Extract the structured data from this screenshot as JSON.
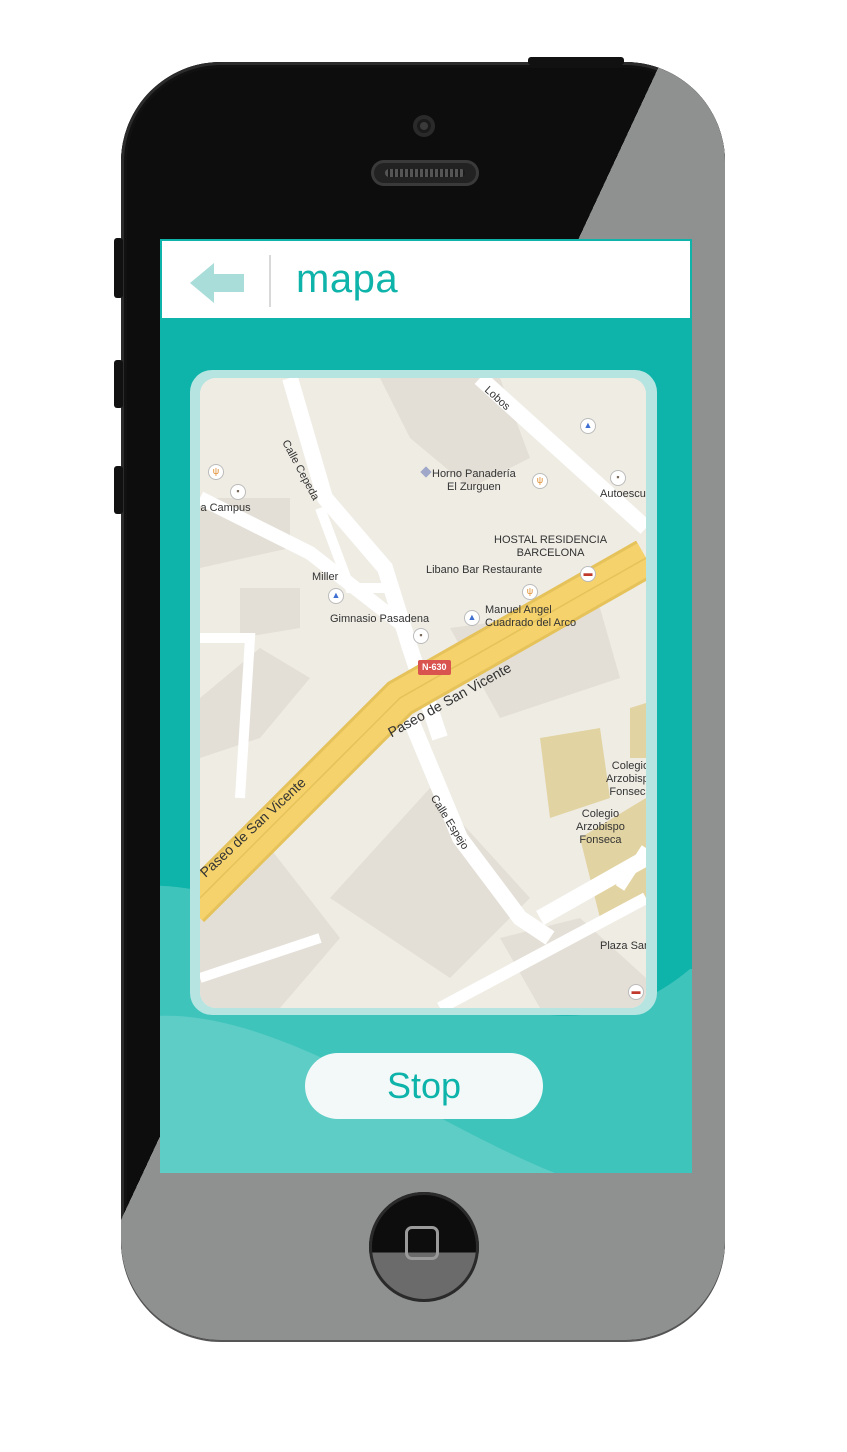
{
  "header": {
    "title": "mapa",
    "back_icon": "back-arrow-icon"
  },
  "map": {
    "streets": [
      "Calle Cepeda",
      "Lobos",
      "Paseo de San Vicente",
      "Paseo de San Vicente",
      "Calle Espejo"
    ],
    "road_badge": "N-630",
    "places": [
      {
        "label": "Horno Panadería\nEl Zurguen",
        "icon": "restaurant-icon"
      },
      {
        "label": "Autoescu",
        "icon": "dot-icon"
      },
      {
        "label": "la Campus",
        "icon": "dot-icon"
      },
      {
        "label": "HOSTAL RESIDENCIA\nBARCELONA",
        "icon": "hotel-icon"
      },
      {
        "label": "Libano Bar Restaurante",
        "icon": "restaurant-icon"
      },
      {
        "label": "Miller",
        "icon": "shop-icon"
      },
      {
        "label": "Gimnasio Pasadena",
        "icon": "dot-icon"
      },
      {
        "label": "Manuel Angel\nCuadrado del Arco",
        "icon": "shop-icon"
      },
      {
        "label": "Colegio\nArzobispo\nFonseca",
        "icon": "none"
      },
      {
        "label": "Colegio\nArzobispo\nFonseca",
        "icon": "none"
      },
      {
        "label": "Plaza San",
        "icon": "none"
      }
    ]
  },
  "actions": {
    "stop_label": "Stop"
  },
  "colors": {
    "accent": "#0eb3aa",
    "accent_light": "#5dcdc6",
    "road": "#f5d26b"
  }
}
